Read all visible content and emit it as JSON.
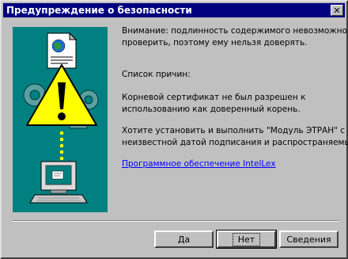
{
  "window": {
    "title": "Предупреждение о безопасности",
    "close_glyph": "✕"
  },
  "body": {
    "warning_line1": "Внимание: подлинность содержимого невозможно",
    "warning_line2": "проверить, поэтому ему нельзя доверять.",
    "reasons_heading": "Список причин:",
    "reason_line1": "Корневой сертификат не был разрешен к",
    "reason_line2": "использованию как доверенный корень.",
    "question_line1": "Хотите установить и выполнить \"Модуль ЭТРАН\" с",
    "question_line2": "неизвестной датой подписания и распространяемый:",
    "publisher_link": "Программное обеспечение IntelLex"
  },
  "buttons": {
    "yes": "Да",
    "no": "Нет",
    "details": "Сведения"
  },
  "colors": {
    "titlebar": "#000080",
    "panel": "#008080",
    "warning": "#ffff00",
    "link": "#0000ff"
  }
}
